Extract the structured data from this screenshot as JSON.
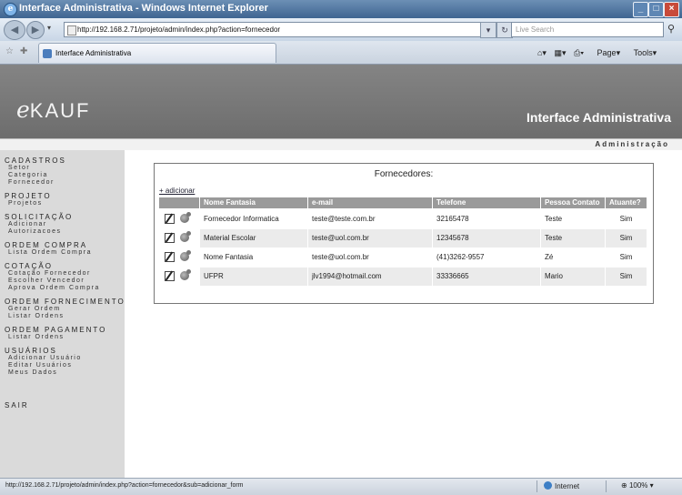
{
  "window": {
    "title": "Interface Administrativa - Windows Internet Explorer"
  },
  "browser": {
    "url": "http://192.168.2.71/projeto/admin/index.php?action=fornecedor",
    "search_placeholder": "Live Search",
    "tab_title": "Interface Administrativa",
    "tools": {
      "page": "Page",
      "tools": "Tools"
    }
  },
  "site": {
    "logo": "eKAUF",
    "header_title": "Interface Administrativa",
    "subheader": "Administração"
  },
  "sidebar": {
    "sections": [
      {
        "title": "CADASTROS",
        "items": [
          "Setor",
          "Categoria",
          "Fornecedor"
        ]
      },
      {
        "title": "PROJETO",
        "items": [
          "Projetos"
        ]
      },
      {
        "title": "SOLICITAÇÃO",
        "items": [
          "Adicionar",
          "Autorizacoes"
        ]
      },
      {
        "title": "ORDEM COMPRA",
        "items": [
          "Lista Ordem Compra"
        ]
      },
      {
        "title": "COTAÇÃO",
        "items": [
          "Cotação Fornecedor",
          "Escolher Vencedor",
          "Aprova Ordem Compra"
        ]
      },
      {
        "title": "ORDEM FORNECIMENTO",
        "items": [
          "Gerar Ordem",
          "Listar Ordens"
        ]
      },
      {
        "title": "ORDEM PAGAMENTO",
        "items": [
          "Listar Ordens"
        ]
      },
      {
        "title": "USUÁRIOS",
        "items": [
          "Adicionar Usuário",
          "Editar Usuários",
          "Meus Dados"
        ]
      },
      {
        "title": "SAIR",
        "items": []
      }
    ]
  },
  "panel": {
    "title": "Fornecedores:",
    "add_link": "+ adicionar",
    "columns": [
      "Nome Fantasia",
      "e-mail",
      "Telefone",
      "Pessoa Contato",
      "Atuante?"
    ],
    "rows": [
      {
        "nome": "Fornecedor Informatica",
        "email": "teste@teste.com.br",
        "telefone": "32165478",
        "contato": "Teste",
        "atuante": "Sim"
      },
      {
        "nome": "Material Escolar",
        "email": "teste@uol.com.br",
        "telefone": "12345678",
        "contato": "Teste",
        "atuante": "Sim"
      },
      {
        "nome": "Nome Fantasia",
        "email": "teste@uol.com.br",
        "telefone": "(41)3262-9557",
        "contato": "Zé",
        "atuante": "Sim"
      },
      {
        "nome": "UFPR",
        "email": "jlv1994@hotmail.com",
        "telefone": "33336665",
        "contato": "Mario",
        "atuante": "Sim"
      }
    ]
  },
  "statusbar": {
    "link_url": "http://192.168.2.71/projeto/admin/index.php?action=fornecedor&sub=adicionar_form",
    "zone": "Internet",
    "zoom": "100%"
  },
  "icons": [
    "ie-icon",
    "back-icon",
    "forward-icon",
    "refresh-icon",
    "stop-icon",
    "search-icon",
    "favorites-star-icon",
    "add-favorite-icon",
    "home-icon",
    "feeds-icon",
    "print-icon",
    "edit-icon",
    "delete-icon",
    "globe-icon"
  ]
}
